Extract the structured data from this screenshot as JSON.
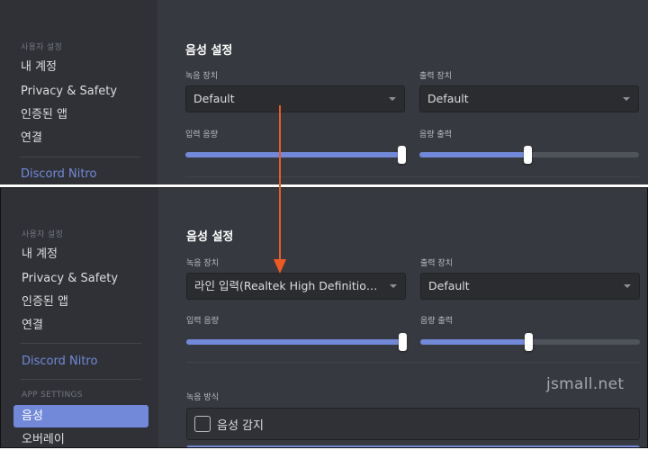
{
  "top_panel": {
    "sidebar": {
      "header": "사용자 설정",
      "items": [
        "내 계정",
        "Privacy & Safety",
        "인증된 앱",
        "연결"
      ],
      "nitro": "Discord Nitro"
    },
    "section_title": "음성 설정",
    "input_device": {
      "label": "녹음 장치",
      "value": "Default"
    },
    "output_device": {
      "label": "출력 장치",
      "value": "Default"
    },
    "input_volume": {
      "label": "입력 음량",
      "level_percent": 100
    },
    "output_volume": {
      "label": "음량 출력",
      "level_percent": 49
    }
  },
  "bottom_panel": {
    "sidebar": {
      "header": "사용자 설정",
      "items": [
        "내 계정",
        "Privacy & Safety",
        "인증된 앱",
        "연결"
      ],
      "nitro": "Discord Nitro",
      "app_settings_header": "APP SETTINGS",
      "app_items": [
        "음성",
        "오버레이"
      ],
      "selected_item": "음성"
    },
    "section_title": "음성 설정",
    "input_device": {
      "label": "녹음 장치",
      "value": "라인 입력(Realtek High Definition Audio)"
    },
    "output_device": {
      "label": "출력 장치",
      "value": "Default"
    },
    "input_volume": {
      "label": "입력 음량",
      "level_percent": 100
    },
    "output_volume": {
      "label": "음량 출력",
      "level_percent": 49
    },
    "input_mode": {
      "label": "녹음 방식",
      "option": "음성 감지",
      "checked": false
    }
  },
  "watermark": "jsmall.net",
  "colors": {
    "background": "#36393f",
    "sidebar": "#2f3136",
    "accent": "#7289da",
    "annotation_arrow": "#f05a22"
  }
}
